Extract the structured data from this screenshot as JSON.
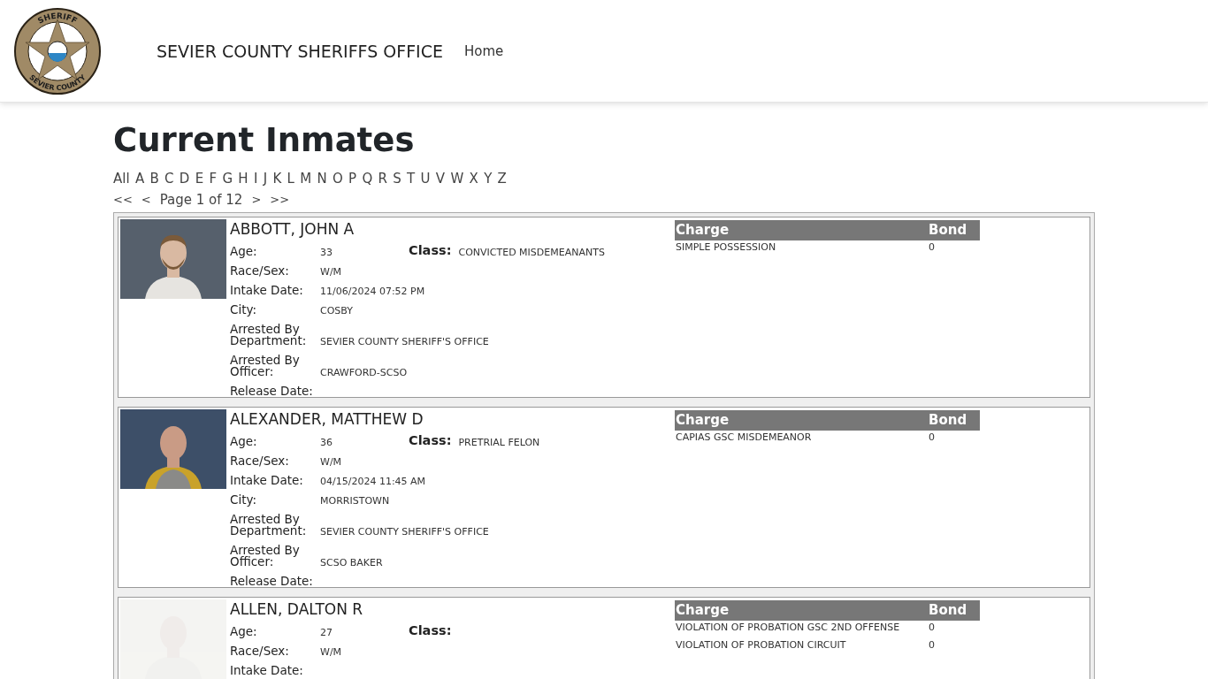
{
  "header": {
    "logo": {
      "top": "SHERIFF",
      "bottom": "SEVIER COUNTY"
    },
    "title": "SEVIER COUNTY SHERIFFS OFFICE",
    "nav": [
      "Home"
    ]
  },
  "page_title": "Current Inmates",
  "letters": [
    "All",
    "A",
    "B",
    "C",
    "D",
    "E",
    "F",
    "G",
    "H",
    "I",
    "J",
    "K",
    "L",
    "M",
    "N",
    "O",
    "P",
    "Q",
    "R",
    "S",
    "T",
    "U",
    "V",
    "W",
    "X",
    "Y",
    "Z"
  ],
  "pager": {
    "first": "<<",
    "prev": "<",
    "label": "Page 1 of 12",
    "next": ">",
    "last": ">>"
  },
  "inmates": [
    {
      "photo": {
        "kind": "picture"
      },
      "name": "ABBOTT, JOHN A",
      "class_label": "Class:",
      "class_value": "CONVICTED MISDEMEANANTS",
      "fields": [
        {
          "label": "Age:",
          "value": "33"
        },
        {
          "label": "Race/Sex:",
          "value": "W/M"
        },
        {
          "label": "Intake Date:",
          "value": "11/06/2024 07:52 PM"
        },
        {
          "label": "City:",
          "value": "COSBY"
        },
        {
          "label": "Arrested By Department:",
          "value": "SEVIER COUNTY SHERIFF'S OFFICE"
        },
        {
          "label": "Arrested By Officer:",
          "value": "CRAWFORD-SCSO"
        },
        {
          "label": "Release Date:"
        }
      ],
      "charge_columns": [
        "Charge",
        "Bond"
      ],
      "charges": [
        {
          "charge": "SIMPLE POSSESSION",
          "bond": "0"
        }
      ]
    },
    {
      "photo": {
        "kind": "picture"
      },
      "name": "ALEXANDER, MATTHEW D",
      "class_label": "Class:",
      "class_value": "PRETRIAL FELON",
      "fields": [
        {
          "label": "Age:",
          "value": "36"
        },
        {
          "label": "Race/Sex:",
          "value": "W/M"
        },
        {
          "label": "Intake Date:",
          "value": "04/15/2024 11:45 AM"
        },
        {
          "label": "City:",
          "value": "MORRISTOWN"
        },
        {
          "label": "Arrested By Department:",
          "value": "SEVIER COUNTY SHERIFF'S OFFICE"
        },
        {
          "label": "Arrested By Officer:",
          "value": "SCSO BAKER"
        },
        {
          "label": "Release Date:"
        }
      ],
      "charge_columns": [
        "Charge",
        "Bond"
      ],
      "charges": [
        {
          "charge": "CAPIAS GSC MISDEMEANOR",
          "bond": "0"
        }
      ]
    },
    {
      "photo": {
        "kind": "picture"
      },
      "name": "ALLEN, DALTON R",
      "class_label": "Class:",
      "fields": [
        {
          "label": "Age:",
          "value": "27"
        },
        {
          "label": "Race/Sex:",
          "value": "W/M"
        },
        {
          "label": "Intake Date:"
        }
      ],
      "charge_columns": [
        "Charge",
        "Bond"
      ],
      "charges": [
        {
          "charge": "VIOLATION OF PROBATION GSC 2ND OFFENSE",
          "bond": "0"
        },
        {
          "charge": "VIOLATION OF PROBATION CIRCUIT",
          "bond": "0"
        }
      ]
    }
  ]
}
